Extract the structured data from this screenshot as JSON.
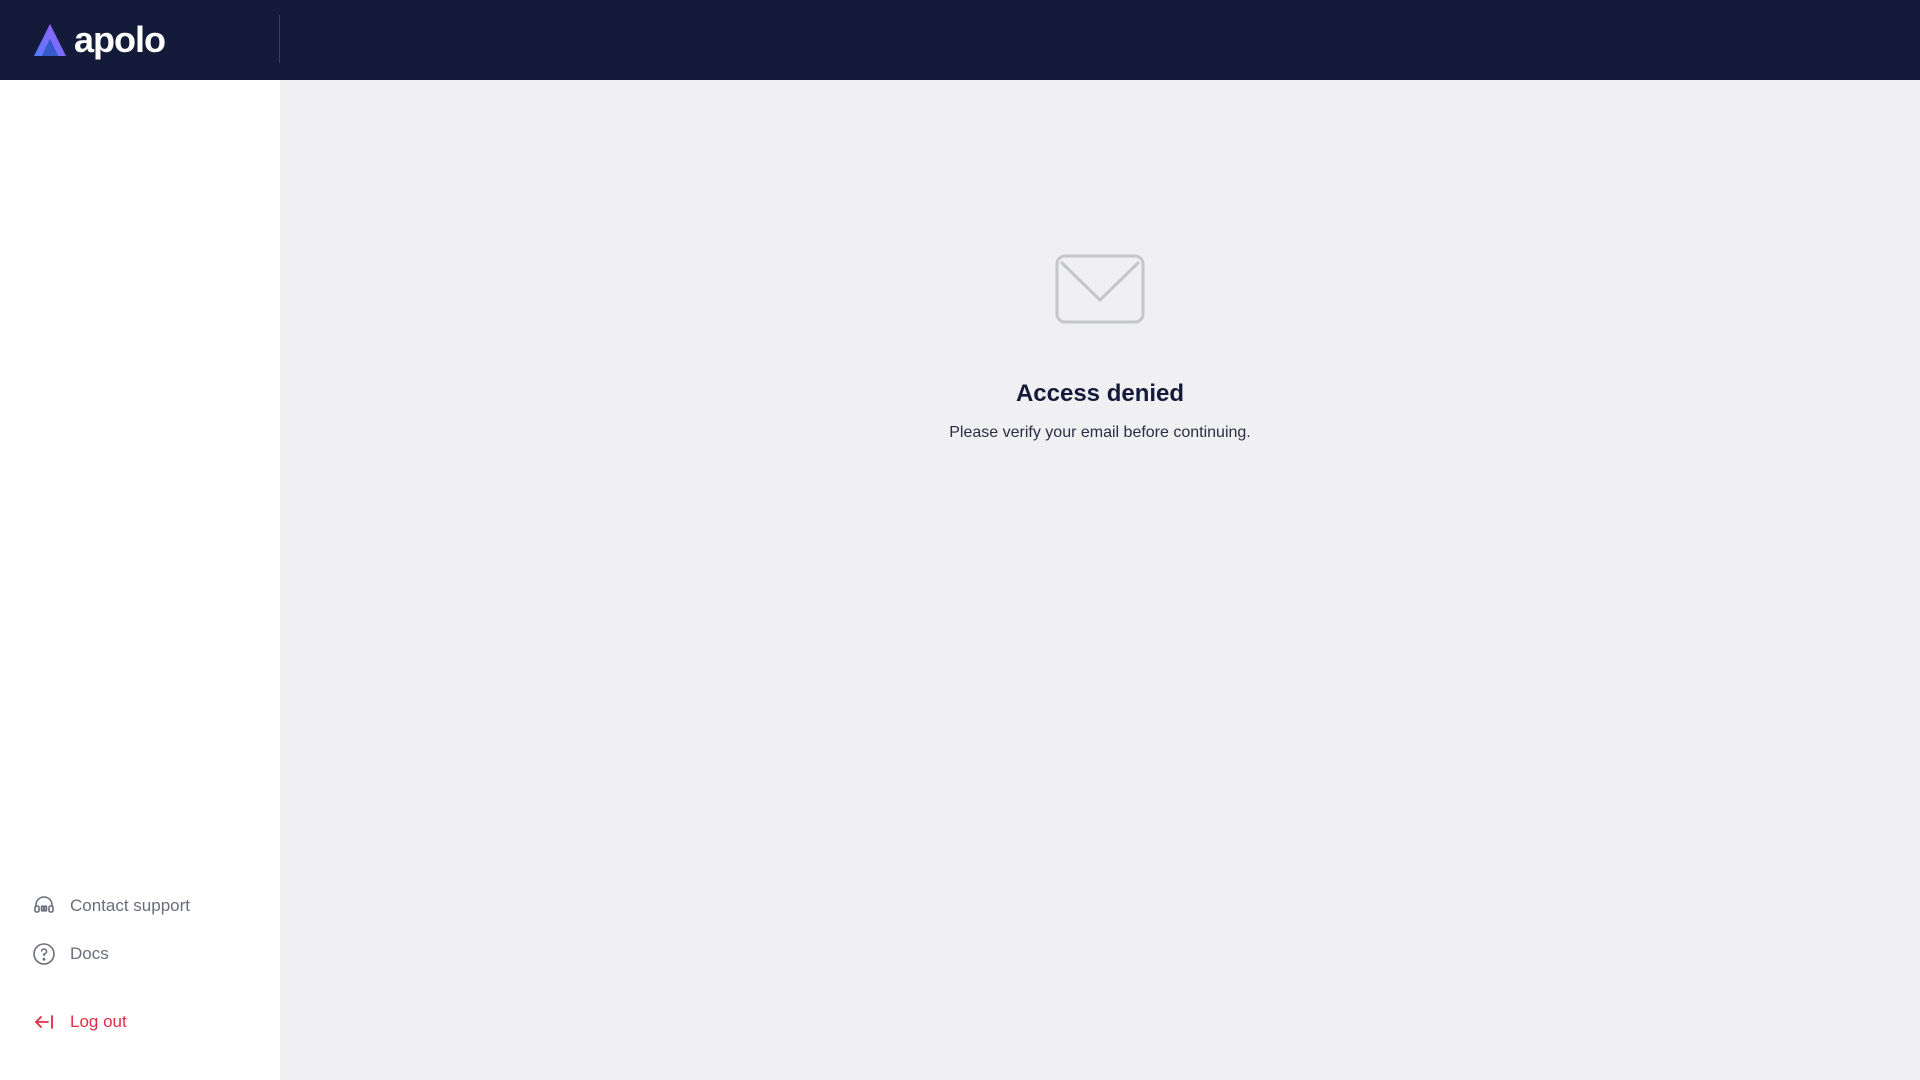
{
  "header": {
    "logo_text": "apolo",
    "colors": {
      "background": "#141a3a",
      "logo_gradient_start": "#4f7dff",
      "logo_gradient_end": "#a65cff"
    }
  },
  "sidebar": {
    "items": [
      {
        "label": "Contact support",
        "icon": "headset-icon"
      },
      {
        "label": "Docs",
        "icon": "help-circle-icon"
      }
    ],
    "logout": {
      "label": "Log out",
      "icon": "logout-arrow-icon",
      "color": "#e02e44"
    }
  },
  "main": {
    "icon": "envelope-icon",
    "title": "Access denied",
    "message": "Please verify your email before continuing."
  }
}
